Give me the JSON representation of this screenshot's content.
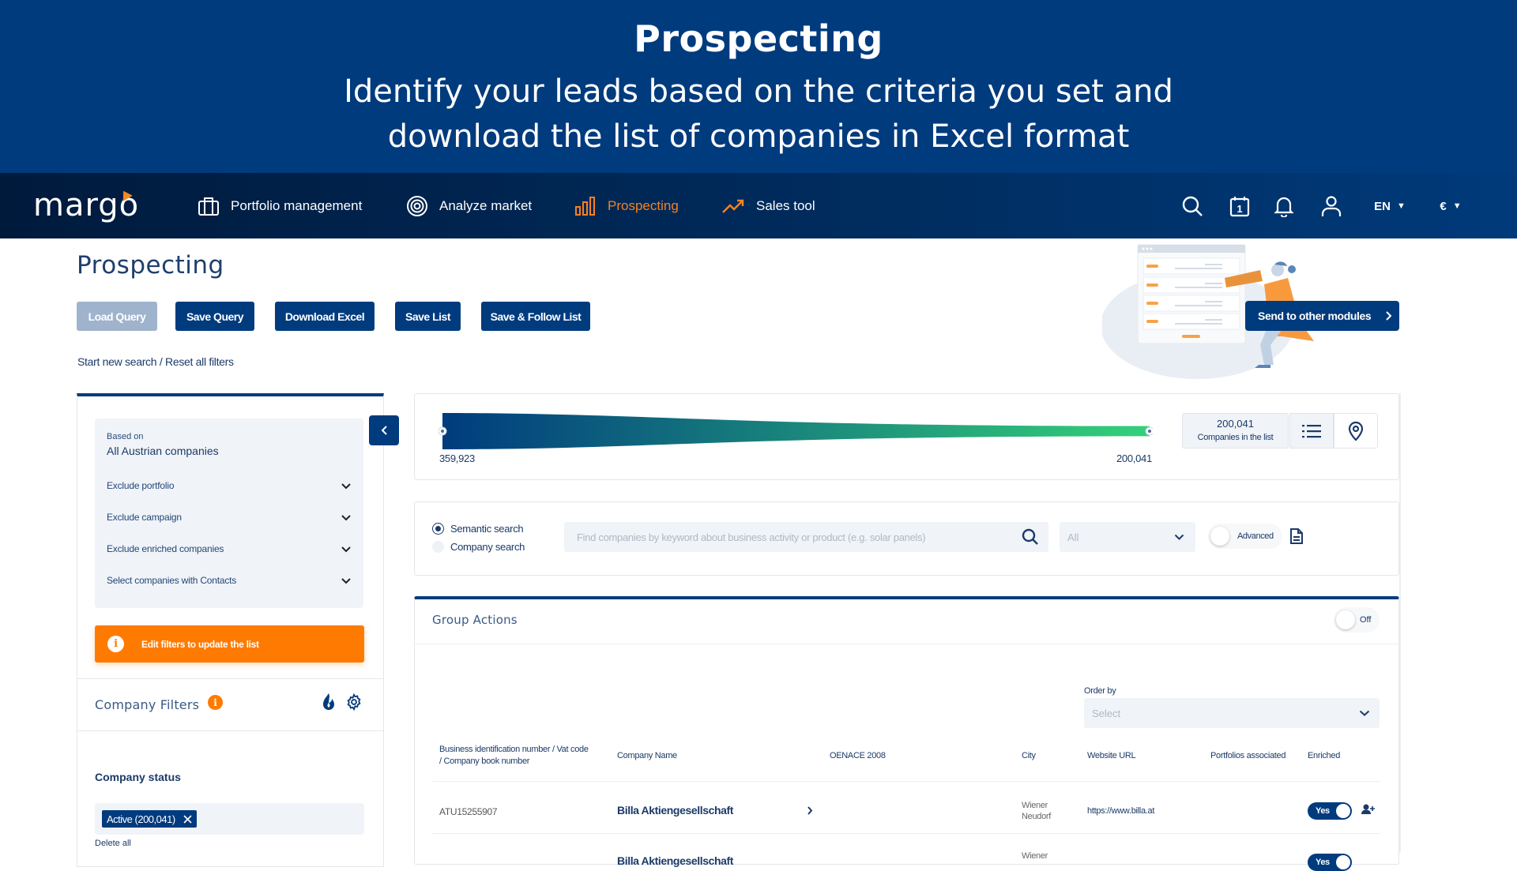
{
  "banner": {
    "title": "Prospecting",
    "subtitle_line1": "Identify your leads based on the criteria you set and",
    "subtitle_line2": "download the list of companies in Excel format"
  },
  "nav": {
    "logo": "margo",
    "items": [
      {
        "label": "Portfolio management",
        "icon": "briefcase-icon",
        "active": false
      },
      {
        "label": "Analyze market",
        "icon": "target-icon",
        "active": false
      },
      {
        "label": "Prospecting",
        "icon": "bar-chart-icon",
        "active": true
      },
      {
        "label": "Sales tool",
        "icon": "trending-up-icon",
        "active": false
      }
    ],
    "right": {
      "search_icon": "search-icon",
      "calendar_icon": "calendar-icon",
      "calendar_day": "1",
      "bell_icon": "bell-icon",
      "user_icon": "user-icon",
      "language": "EN",
      "currency": "€"
    },
    "accent_color": "#f58220"
  },
  "page": {
    "title": "Prospecting",
    "buttons": {
      "load_query": "Load Query",
      "save_query": "Save Query",
      "download_excel": "Download Excel",
      "save_list": "Save List",
      "save_follow_list": "Save & Follow List"
    },
    "reset_link": "Start new search / Reset all filters",
    "send_to_modules": "Send to other modules"
  },
  "left_panel": {
    "based_on_label": "Based on",
    "based_on_value": "All Austrian companies",
    "accordions": [
      {
        "label": "Exclude portfolio"
      },
      {
        "label": "Exclude campaign"
      },
      {
        "label": "Exclude enriched companies"
      },
      {
        "label": "Select companies with Contacts"
      }
    ],
    "edit_banner": "Edit filters to update the list",
    "company_filters_title": "Company Filters",
    "company_status_label": "Company status",
    "status_chip": "Active (200,041)",
    "delete_all": "Delete all"
  },
  "funnel": {
    "start_value": "359,923",
    "end_value": "200,041",
    "start_count": 359923,
    "end_count": 200041,
    "count": "200,041",
    "count_label": "Companies in the list",
    "gradient_start": "#003b7e",
    "gradient_end": "#34d17a"
  },
  "search": {
    "modes": [
      {
        "label": "Semantic search",
        "selected": true
      },
      {
        "label": "Company search",
        "selected": false
      }
    ],
    "placeholder": "Find companies by keyword about business activity or product (e.g. solar panels)",
    "scope_value": "All",
    "advanced_label": "Advanced"
  },
  "group_actions": {
    "title": "Group Actions",
    "toggle_label": "Off",
    "order_by_label": "Order by",
    "order_by_placeholder": "Select"
  },
  "table": {
    "columns": [
      "Business identification number / Vat code / Company book number",
      "Company Name",
      "OENACE 2008",
      "City",
      "Website URL",
      "Portfolios associated",
      "Enriched"
    ],
    "rows": [
      {
        "id": "ATU15255907",
        "name": "Billa Aktiengesellschaft",
        "oenace": "",
        "city_line1": "Wiener",
        "city_line2": "Neudorf",
        "url": "https://www.billa.at",
        "portfolios": "",
        "enriched": "Yes"
      },
      {
        "id": "",
        "name": "Billa Aktiengesellschaft",
        "oenace": "",
        "city_line1": "Wiener",
        "city_line2": "",
        "url": "",
        "portfolios": "",
        "enriched": "Yes"
      }
    ]
  }
}
